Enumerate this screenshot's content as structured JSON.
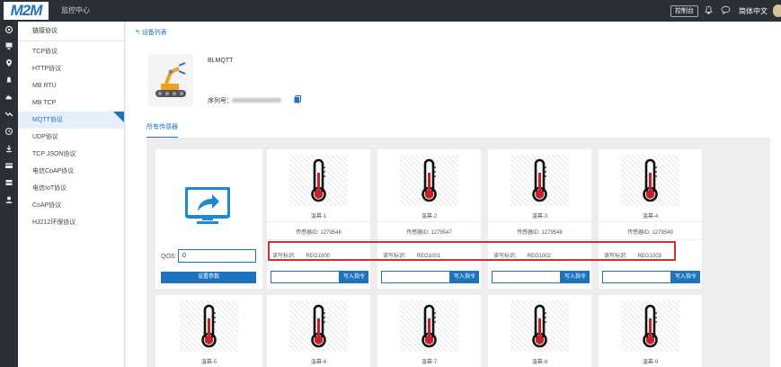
{
  "header": {
    "logo": "M2M",
    "title": "监控中心",
    "console_label": "控制台",
    "lang_label": "简体中文",
    "icons": [
      "bell-icon",
      "chat-icon"
    ]
  },
  "rail": {
    "icons": [
      "home-icon",
      "monitor-icon",
      "location-icon",
      "alarm-icon",
      "cloud-icon",
      "link-icon",
      "clock-icon",
      "download-icon",
      "card-icon",
      "server-icon",
      "user-icon"
    ]
  },
  "sidebar": {
    "heading": "链接协议",
    "items": [
      {
        "label": "TCP协议"
      },
      {
        "label": "HTTP协议"
      },
      {
        "label": "MB RTU"
      },
      {
        "label": "MB TCP"
      },
      {
        "label": "MQTT协议"
      },
      {
        "label": "UDP协议"
      },
      {
        "label": "TCP JSON协议"
      },
      {
        "label": "电信CoAP协议"
      },
      {
        "label": "电信IoT协议"
      },
      {
        "label": "CoAP协议"
      },
      {
        "label": "HJ212环保协议"
      }
    ],
    "active_index": 4
  },
  "device": {
    "back_label": "设备列表",
    "name": "BLMQTT",
    "serial_label": "序列号："
  },
  "tabs": {
    "sensors": "所有传感器"
  },
  "qos_panel": {
    "qos_label": "QOS:",
    "qos_value": "0",
    "set_button": "设置参数"
  },
  "sensors": [
    {
      "name": "温幕-1",
      "id_text": "传感器ID: 1279546",
      "rw_label": "读写标识:",
      "rw_value": "REG1000",
      "write_btn": "写入指令"
    },
    {
      "name": "温幕-2",
      "id_text": "传感器ID: 1279547",
      "rw_label": "读写标识:",
      "rw_value": "REG1001",
      "write_btn": "写入指令"
    },
    {
      "name": "温幕-3",
      "id_text": "传感器ID: 1279548",
      "rw_label": "读写标识:",
      "rw_value": "REG1002",
      "write_btn": "写入指令"
    },
    {
      "name": "温幕-4",
      "id_text": "传感器ID: 1279549",
      "rw_label": "读写标识:",
      "rw_value": "REG1003",
      "write_btn": "写入指令"
    },
    {
      "name": "温幕-5"
    },
    {
      "name": "温幕-6"
    },
    {
      "name": "温幕-7"
    },
    {
      "name": "温幕-8"
    },
    {
      "name": "温幕-9"
    }
  ],
  "colors": {
    "accent": "#1e73be",
    "topbar": "#2b2f36",
    "highlight": "#d62e2e",
    "thermo_red": "#c8202a"
  }
}
